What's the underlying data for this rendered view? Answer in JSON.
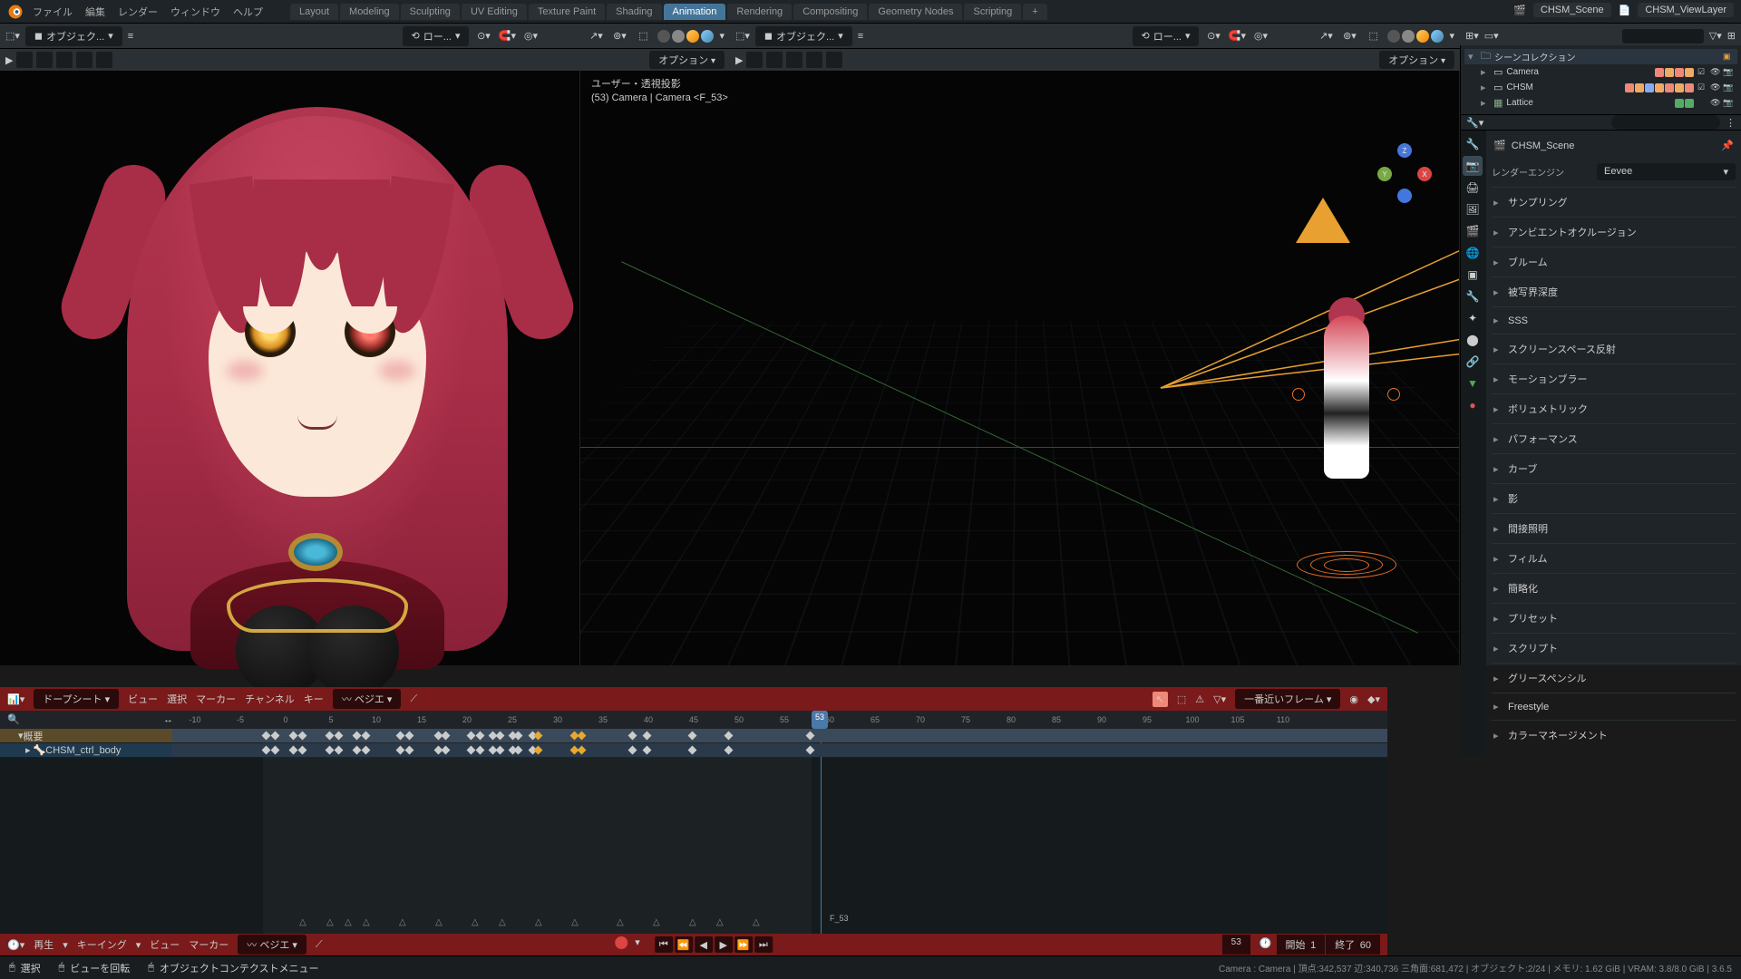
{
  "menu": [
    "ファイル",
    "編集",
    "レンダー",
    "ウィンドウ",
    "ヘルプ"
  ],
  "tabs": [
    "Layout",
    "Modeling",
    "Sculpting",
    "UV Editing",
    "Texture Paint",
    "Shading",
    "Animation",
    "Rendering",
    "Compositing",
    "Geometry Nodes",
    "Scripting"
  ],
  "tabs_active": 6,
  "scene_name": "CHSM_Scene",
  "viewlayer": "CHSM_ViewLayer",
  "mode": "オブジェク...",
  "transform_orient": "ロー...",
  "options_label": "オプション",
  "vp2_label1": "ユーザー・透視投影",
  "vp2_label2": "(53) Camera | Camera <F_53>",
  "outliner": {
    "root": "シーンコレクション",
    "items": [
      {
        "name": "Camera"
      },
      {
        "name": "CHSM"
      },
      {
        "name": "Lattice"
      }
    ]
  },
  "props": {
    "scene": "CHSM_Scene",
    "engine_label": "レンダーエンジン",
    "engine": "Eevee",
    "sections": [
      "サンプリング",
      "アンビエントオクルージョン",
      "ブルーム",
      "被写界深度",
      "SSS",
      "スクリーンスペース反射",
      "モーションブラー",
      "ボリュメトリック",
      "パフォーマンス",
      "カーブ",
      "影",
      "間接照明",
      "フィルム",
      "簡略化",
      "プリセット",
      "スクリプト",
      "グリースペンシル",
      "Freestyle",
      "カラーマネージメント"
    ]
  },
  "dope": {
    "mode": "ドープシート",
    "menus": [
      "ビュー",
      "選択",
      "マーカー",
      "チャンネル",
      "キー"
    ],
    "interp": "ベジエ",
    "snap": "一番近いフレーム",
    "ruler": [
      "-10",
      "-5",
      "0",
      "5",
      "10",
      "15",
      "20",
      "25",
      "30",
      "35",
      "40",
      "45",
      "50",
      "55",
      "60",
      "65",
      "70",
      "75",
      "80",
      "85",
      "90",
      "95",
      "100",
      "105",
      "110"
    ],
    "current_frame": "53",
    "tracks": [
      {
        "name": "概要"
      },
      {
        "name": "CHSM_ctrl_body"
      }
    ],
    "frame_marker": "F_53"
  },
  "playbar": {
    "menus": [
      "再生",
      "キーイング",
      "ビュー",
      "マーカー"
    ],
    "interp": "ベジエ",
    "frame_cur": "53",
    "start_lbl": "開始",
    "start": "1",
    "end_lbl": "終了",
    "end": "60"
  },
  "status": {
    "select": "選択",
    "rotate": "ビューを回転",
    "context": "オブジェクトコンテクストメニュー",
    "stats": "Camera : Camera | 頂点:342,537  辺:340,736  三角面:681,472 | オブジェクト:2/24 | メモリ: 1.62 GiB | VRAM: 3.8/8.0 GiB | 3.6.5"
  },
  "gizmo": {
    "x": "X",
    "y": "Y",
    "z": "Z"
  }
}
